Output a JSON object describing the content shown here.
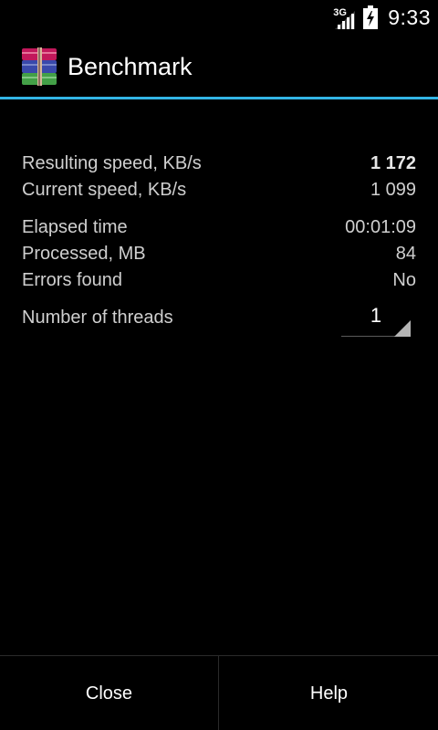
{
  "status_bar": {
    "network_type": "3G",
    "time": "9:33",
    "icons": [
      "signal-icon",
      "battery-charging-icon"
    ]
  },
  "title_bar": {
    "title": "Benchmark",
    "icon": "winrar-books-icon",
    "accent_color": "#33b5e5"
  },
  "stats": {
    "resulting_speed": {
      "label": "Resulting speed, KB/s",
      "value": "1 172"
    },
    "current_speed": {
      "label": "Current speed, KB/s",
      "value": "1 099"
    },
    "elapsed_time": {
      "label": "Elapsed time",
      "value": "00:01:09"
    },
    "processed": {
      "label": "Processed, MB",
      "value": "84"
    },
    "errors": {
      "label": "Errors found",
      "value": "No"
    },
    "threads": {
      "label": "Number of threads",
      "value": "1"
    }
  },
  "buttons": {
    "close": "Close",
    "help": "Help"
  }
}
